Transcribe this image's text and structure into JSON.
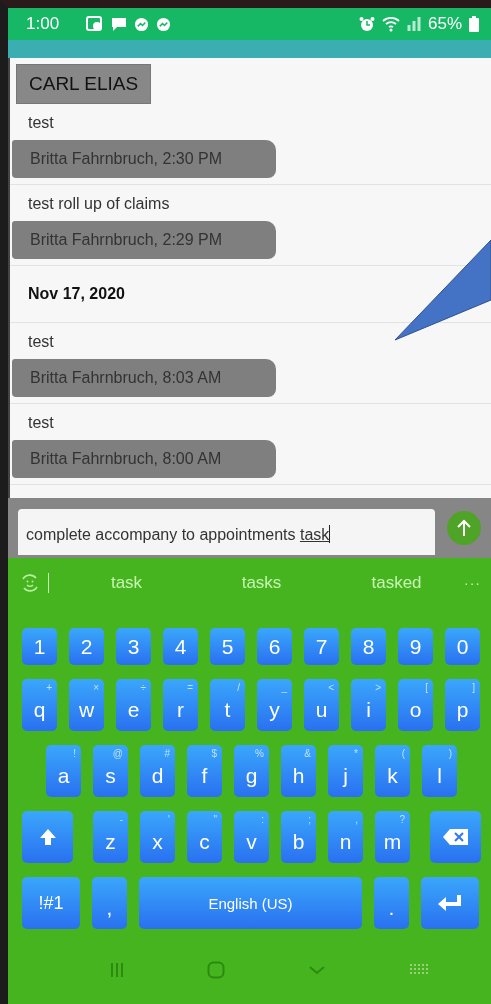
{
  "status_bar": {
    "time": "1:00",
    "battery": "65%"
  },
  "contact": {
    "name": "CARL ELIAS"
  },
  "messages": [
    {
      "kind": "note",
      "text": "test",
      "author": "Britta Fahrnbruch, 2:30 PM"
    },
    {
      "kind": "note",
      "text": "test roll up of claims",
      "author": "Britta Fahrnbruch, 2:29 PM"
    },
    {
      "kind": "date",
      "text": "Nov 17, 2020"
    },
    {
      "kind": "note",
      "text": "test",
      "author": "Britta Fahrnbruch, 8:03 AM"
    },
    {
      "kind": "note",
      "text": "test",
      "author": "Britta Fahrnbruch, 8:00 AM"
    }
  ],
  "composer": {
    "value": "complete accompany to appointments ",
    "current_word": "task"
  },
  "suggestions": [
    "task",
    "tasks",
    "tasked"
  ],
  "suggestion_more": "···",
  "keyboard": [
    [
      {
        "kind": "num",
        "label": "1"
      },
      {
        "kind": "num",
        "label": "2"
      },
      {
        "kind": "num",
        "label": "3"
      },
      {
        "kind": "num",
        "label": "4"
      },
      {
        "kind": "num",
        "label": "5"
      },
      {
        "kind": "num",
        "label": "6"
      },
      {
        "kind": "num",
        "label": "7"
      },
      {
        "kind": "num",
        "label": "8"
      },
      {
        "kind": "num",
        "label": "9"
      },
      {
        "kind": "num",
        "label": "0"
      }
    ],
    [
      {
        "kind": "char",
        "label": "q",
        "hint": "+"
      },
      {
        "kind": "char",
        "label": "w",
        "hint": "×"
      },
      {
        "kind": "char",
        "label": "e",
        "hint": "÷"
      },
      {
        "kind": "char",
        "label": "r",
        "hint": "="
      },
      {
        "kind": "char",
        "label": "t",
        "hint": "/"
      },
      {
        "kind": "char",
        "label": "y",
        "hint": "_"
      },
      {
        "kind": "char",
        "label": "u",
        "hint": "<"
      },
      {
        "kind": "char",
        "label": "i",
        "hint": ">"
      },
      {
        "kind": "char",
        "label": "o",
        "hint": "["
      },
      {
        "kind": "char",
        "label": "p",
        "hint": "]"
      }
    ],
    [
      {
        "kind": "char",
        "label": "a",
        "hint": "!"
      },
      {
        "kind": "char",
        "label": "s",
        "hint": "@"
      },
      {
        "kind": "char",
        "label": "d",
        "hint": "#"
      },
      {
        "kind": "char",
        "label": "f",
        "hint": "$"
      },
      {
        "kind": "char",
        "label": "g",
        "hint": "%"
      },
      {
        "kind": "char",
        "label": "h",
        "hint": "&"
      },
      {
        "kind": "char",
        "label": "j",
        "hint": "*"
      },
      {
        "kind": "char",
        "label": "k",
        "hint": "("
      },
      {
        "kind": "char",
        "label": "l",
        "hint": ")"
      }
    ],
    [
      {
        "kind": "shift"
      },
      {
        "kind": "char",
        "label": "z",
        "hint": "-"
      },
      {
        "kind": "char",
        "label": "x",
        "hint": "'"
      },
      {
        "kind": "char",
        "label": "c",
        "hint": "\""
      },
      {
        "kind": "char",
        "label": "v",
        "hint": ":"
      },
      {
        "kind": "char",
        "label": "b",
        "hint": ";"
      },
      {
        "kind": "char",
        "label": "n",
        "hint": ","
      },
      {
        "kind": "char",
        "label": "m",
        "hint": "?"
      },
      {
        "kind": "backspace"
      }
    ],
    [
      {
        "kind": "symbols",
        "label": "!#1"
      },
      {
        "kind": "char",
        "label": ","
      },
      {
        "kind": "space",
        "label": "English (US)"
      },
      {
        "kind": "char",
        "label": "."
      },
      {
        "kind": "enter"
      }
    ]
  ]
}
